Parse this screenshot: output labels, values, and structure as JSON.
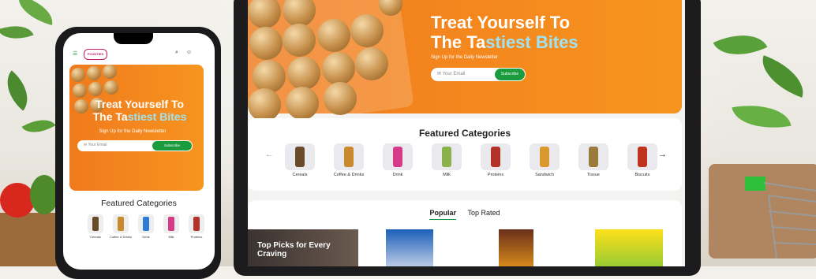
{
  "desktop": {
    "hero": {
      "title_line1": "Treat Yourself To",
      "title_line2_a": "The Ta",
      "title_line2_b": "stiest Bites",
      "newsletter_text": "Sign Up for the Daily Newsletter",
      "email_placeholder": "Your Email",
      "subscribe_label": "Subscribe"
    },
    "featured": {
      "title": "Featured Categories",
      "prev_icon": "←",
      "next_icon": "→",
      "categories": [
        {
          "label": "Cereals",
          "color": "#6b4a2a"
        },
        {
          "label": "Coffee & Drinks",
          "color": "#c98a2e"
        },
        {
          "label": "Drink",
          "color": "#d83a8a"
        },
        {
          "label": "Milk",
          "color": "#8bb24a"
        },
        {
          "label": "Proteins",
          "color": "#b4322a"
        },
        {
          "label": "Sandwich",
          "color": "#d8982e"
        },
        {
          "label": "Tissue",
          "color": "#9a7b3a"
        },
        {
          "label": "Biscuits",
          "color": "#c0321e"
        }
      ]
    },
    "tabs": {
      "popular": "Popular",
      "top_rated": "Top Rated"
    },
    "promo": {
      "title": "Top Picks for Every Craving"
    }
  },
  "mobile": {
    "logo_text": "FOODTIES",
    "hero": {
      "title_line1": "Treat Yourself To",
      "title_line2_a": "The Ta",
      "title_line2_b": "stiest Bites",
      "newsletter_text": "Sign Up for the Daily Newsletter",
      "email_placeholder": "Your Email",
      "subscribe_label": "Subscribe"
    },
    "featured_title": "Featured Categories",
    "categories": [
      {
        "label": "Cereals",
        "color": "#6b4a2a"
      },
      {
        "label": "Coffee & Drinks",
        "color": "#c98a2e"
      },
      {
        "label": "Drink",
        "color": "#2e7bd8"
      },
      {
        "label": "Milk",
        "color": "#d83a8a"
      },
      {
        "label": "Proteins",
        "color": "#b4322a"
      }
    ]
  },
  "colors": {
    "brand_orange": "#f7941f",
    "accent_green": "#1a9b3e",
    "highlight": "#9fe3f2"
  }
}
